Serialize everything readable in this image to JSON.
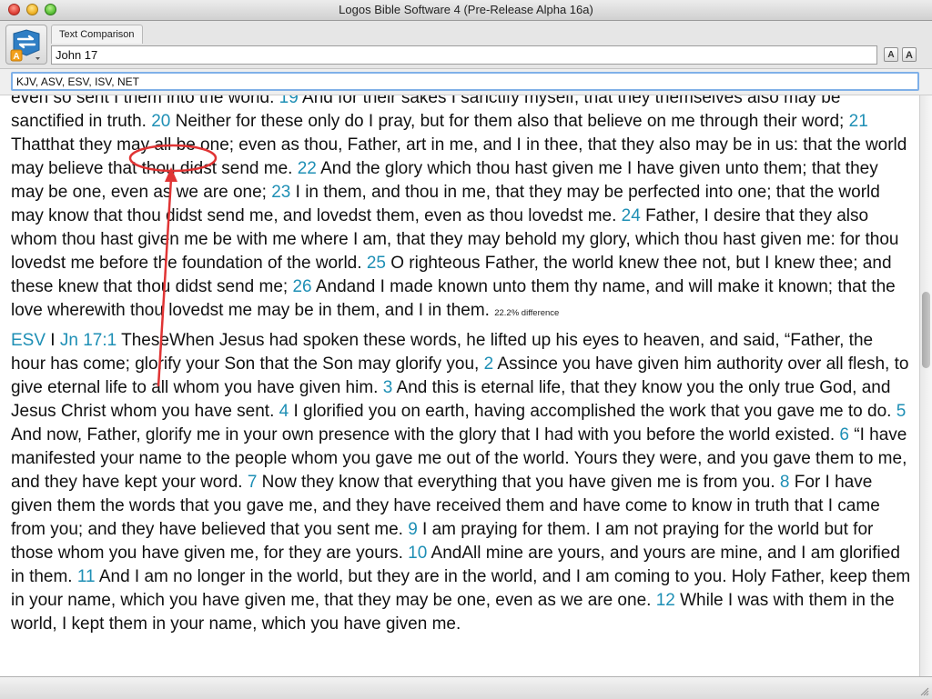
{
  "window": {
    "title": "Logos Bible Software 4 (Pre-Release Alpha 16a)"
  },
  "toolbar": {
    "app_badge": "A",
    "tab_label": "Text Comparison",
    "reference_value": "John 17",
    "font_decrease_label": "A",
    "font_increase_label": "A"
  },
  "versions": {
    "value": "KJV, ASV, ESV, ISV, NET"
  },
  "colors": {
    "verse_number": "#1e8fb5",
    "annotation": "#e03434",
    "focus_ring": "#7fb0e8"
  },
  "passage": {
    "kjv_tail": [
      {
        "t": "even so sent I them into the world. "
      },
      {
        "v": "19"
      },
      {
        "t": "  And for their sakes I sanctify myself, that they themselves also may be sanctified in truth. "
      },
      {
        "v": "20"
      },
      {
        "t": "  Neither for these only do I pray, but for them also that believe on me through their word; "
      },
      {
        "v": "21"
      },
      {
        "t": "  Thatthat they may all be one; even as thou, Father, art in me, and I in thee, that they also may be in us: that the world may believe that thou didst send me. "
      },
      {
        "v": "22"
      },
      {
        "t": "  And the glory which thou hast given me I have given unto them; that they may be one, even as we are one; "
      },
      {
        "v": "23"
      },
      {
        "t": "  I in them, and thou in me, that they may be perfected into one; that the world may know that thou didst send me, and lovedst them, even as thou lovedst me. "
      },
      {
        "v": "24"
      },
      {
        "t": "  Father, I desire that they also whom thou hast given me be with me where I am, that they may behold my glory, which thou hast given me: for thou lovedst me before the foundation of the world. "
      },
      {
        "v": "25"
      },
      {
        "t": "  O righteous Father, the world knew thee not, but I knew thee; and these knew that thou didst send me; "
      },
      {
        "v": "26"
      },
      {
        "t": "  Andand I made known unto them thy name, and will make it known; that the love wherewith thou lovedst me may be in them, and I in them."
      }
    ],
    "kjv_difference": "22.2% difference",
    "esv_version": "ESV",
    "esv_separator": " I ",
    "esv_reference": "Jn 17:1",
    "esv": [
      {
        "t": " TheseWhen Jesus had spoken these words, he lifted up his eyes to heaven, and said, “Father, the hour has come; glorify your Son that the Son may glorify you, "
      },
      {
        "v": "2"
      },
      {
        "t": "  Assince you have given him authority over all flesh, to give eternal life to all whom you have given him. "
      },
      {
        "v": "3"
      },
      {
        "t": "  And this is eternal life, that they know you the only true God, and Jesus Christ whom you have sent. "
      },
      {
        "v": "4"
      },
      {
        "t": "  I glorified you on earth, having accomplished the work that you gave me to do. "
      },
      {
        "v": "5"
      },
      {
        "t": "  And now, Father, glorify me in your own presence with the glory that I had with you before the world existed. "
      },
      {
        "v": "6"
      },
      {
        "t": "  “I have manifested your name to the people whom you gave me out of the world. Yours they were, and you gave them to me, and they have kept your word. "
      },
      {
        "v": "7"
      },
      {
        "t": "  Now they know that everything that you have given me is from you. "
      },
      {
        "v": "8"
      },
      {
        "t": "  For I have given them the words that you gave me, and they have received them and have come to know in truth that I came from you; and they have believed that you sent me. "
      },
      {
        "v": "9"
      },
      {
        "t": "  I am praying for them. I am not praying for the world but for those whom you have given me, for they are yours. "
      },
      {
        "v": "10"
      },
      {
        "t": "  AndAll mine are yours, and yours are mine, and I am glorified in them. "
      },
      {
        "v": "11"
      },
      {
        "t": "  And I am no longer in the world, but they are in the world, and I am coming to you. Holy Father, keep them in your name, which you have given me, that they may be one, even as we are one. "
      },
      {
        "v": "12"
      },
      {
        "t": "  While I was with them in the world, I kept them in your name, which you have given me."
      }
    ]
  },
  "scroll": {
    "position_fraction": 0.42
  }
}
